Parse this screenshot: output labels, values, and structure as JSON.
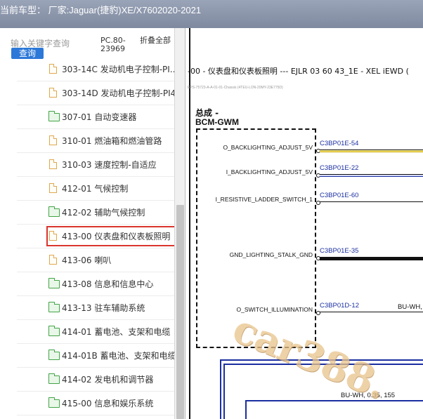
{
  "titlebar": {
    "text": "当前车型：  厂家:Jaguar(捷豹)XE/X7602020-2021"
  },
  "leftpanel": {
    "search_placeholder": "输入关键字查询",
    "query_button": "查询",
    "pc_label": "PC.80-23969",
    "collapse_all": "折叠全部",
    "tree_items": [
      {
        "label": "303-14C 发动机电子控制-PI...",
        "icon": "doc-icon",
        "selected": false
      },
      {
        "label": "303-14D 发动机电子控制-PI4",
        "icon": "doc-icon",
        "selected": false
      },
      {
        "label": "307-01 自动变速器",
        "icon": "folder-icon",
        "selected": false
      },
      {
        "label": "310-01 燃油箱和燃油管路",
        "icon": "doc-icon",
        "selected": false
      },
      {
        "label": "310-03 速度控制-自适应",
        "icon": "doc-icon",
        "selected": false
      },
      {
        "label": "412-01 气候控制",
        "icon": "doc-icon",
        "selected": false
      },
      {
        "label": "412-02 辅助气候控制",
        "icon": "folder-icon",
        "selected": false
      },
      {
        "label": "413-00 仪表盘和仪表板照明",
        "icon": "doc-icon",
        "selected": true
      },
      {
        "label": "413-06 喇叭",
        "icon": "doc-icon",
        "selected": false
      },
      {
        "label": "413-08 信息和信息中心",
        "icon": "folder-icon",
        "selected": false
      },
      {
        "label": "413-13 驻车辅助系统",
        "icon": "folder-icon",
        "selected": false
      },
      {
        "label": "414-01 蓄电池、支架和电缆",
        "icon": "folder-icon",
        "selected": false
      },
      {
        "label": "414-01B 蓄电池、支架和电缆",
        "icon": "folder-icon",
        "selected": false
      },
      {
        "label": "414-02 发电机和调节器",
        "icon": "folder-icon",
        "selected": false
      },
      {
        "label": "415-00 信息和娱乐系统",
        "icon": "folder-icon",
        "selected": false
      }
    ]
  },
  "diagram": {
    "title": "-00 - 仪表盘和仪表板照明 --- EJLR 03 60 43_1E - XEL iEWD (",
    "subtitle": "EPS-75723-A-A-01-01-Chassis (4TEU-LON-20MY-23E775D)",
    "assembly": "总成 -",
    "module": "BCM-GWM",
    "pins": [
      {
        "name": "O_BACKLIGHTING_ADJUST_5V",
        "connector": "C3BP01E-54",
        "wire": "thin"
      },
      {
        "name": "I_BACKLIGHTING_ADJUST_5V",
        "connector": "C3BP01E-22",
        "wire": "blue"
      },
      {
        "name": "I_RESISTIVE_LADDER_SWITCH_1",
        "connector": "C3BP01E-60",
        "wire": "line"
      },
      {
        "name": "GND_LIGHTING_STALK_GND",
        "connector": "C3BP01E-35",
        "wire": "black"
      },
      {
        "name": "O_SWITCH_ILLUMINATION",
        "connector": "C3BP01D-12",
        "wire": "line"
      }
    ],
    "wire_color_1": "BU-WH,",
    "wire_spec_2": "BU-WH, 0.35, 155",
    "watermark": "car388."
  }
}
